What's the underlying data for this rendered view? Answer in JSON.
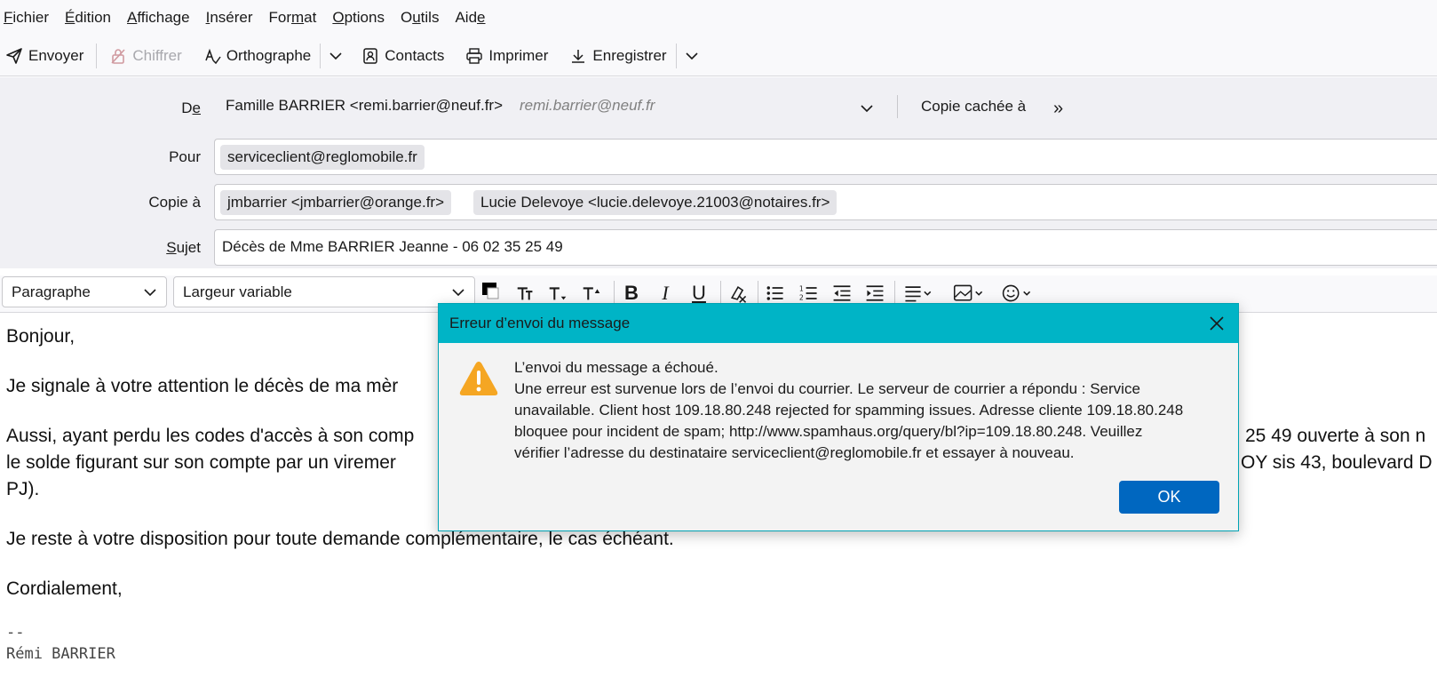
{
  "menu": {
    "items": [
      {
        "pre": "",
        "u": "F",
        "post": "ichier"
      },
      {
        "pre": "",
        "u": "É",
        "post": "dition"
      },
      {
        "pre": "",
        "u": "A",
        "post": "ffichage"
      },
      {
        "pre": "",
        "u": "I",
        "post": "nsérer"
      },
      {
        "pre": "For",
        "u": "m",
        "post": "at"
      },
      {
        "pre": "",
        "u": "O",
        "post": "ptions"
      },
      {
        "pre": "O",
        "u": "u",
        "post": "tils"
      },
      {
        "pre": "Aid",
        "u": "e",
        "post": ""
      }
    ]
  },
  "toolbar": {
    "send": "Envoyer",
    "encrypt": "Chiffrer",
    "spelling": "Orthographe",
    "contacts": "Contacts",
    "print": "Imprimer",
    "save": "Enregistrer"
  },
  "header": {
    "from_label_pre": "D",
    "from_label_u": "e",
    "from_value": "Famille BARRIER <remi.barrier@neuf.fr>",
    "from_placeholder": "remi.barrier@neuf.fr",
    "bcc_label": "Copie cachée à",
    "to_label": "Pour",
    "to_value": "serviceclient@reglomobile.fr",
    "cc_label": "Copie à",
    "cc_values": [
      "jmbarrier <jmbarrier@orange.fr>",
      "Lucie Delevoye <lucie.delevoye.21003@notaires.fr>"
    ],
    "subject_label_u": "S",
    "subject_label_post": "ujet",
    "subject_value": "Décès de Mme BARRIER Jeanne - 06 02 35 25 49"
  },
  "format": {
    "paragraph": "Paragraphe",
    "font": "Largeur variable",
    "text_color": "#000000"
  },
  "body": {
    "greeting": "Bonjour,",
    "line1": "Je signale à votre attention le décès de ma mèr",
    "line2a": "Aussi, ayant perdu les codes d'accès à son comp",
    "line2a_right": "25 49 ouverte à son n",
    "line2b": "le solde figurant sur son compte par un viremer",
    "line2b_right": "OY sis 43, boulevard D",
    "line2c": "PJ).",
    "line3": "Je reste à votre disposition pour toute demande complémentaire, le cas échéant.",
    "closing": "Cordialement,",
    "sig_dash": "--",
    "sig_name": "Rémi BARRIER"
  },
  "dialog": {
    "title": "Erreur d’envoi du message",
    "line1": "L’envoi du message a échoué.",
    "line2": "Une erreur est survenue lors de l’envoi du courrier. Le serveur de courrier a répondu : Service",
    "line3": "unavailable. Client host 109.18.80.248 rejected for spamming issues. Adresse cliente 109.18.80.248",
    "line4": "bloquee pour incident de spam; http://www.spamhaus.org/query/bl?ip=109.18.80.248. Veuillez",
    "line5": "vérifier l’adresse du destinataire serviceclient@reglomobile.fr et essayer à nouveau.",
    "ok": "OK"
  }
}
